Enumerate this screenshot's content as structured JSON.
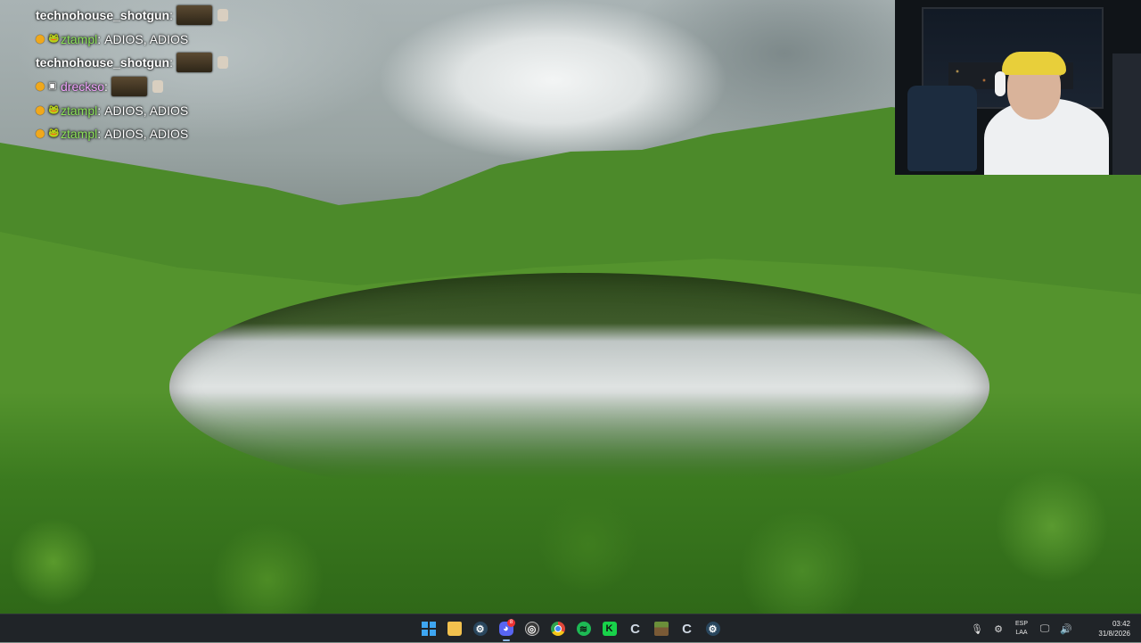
{
  "chat": {
    "messages": [
      {
        "user": "technohouse_shotgun",
        "separator": ":",
        "text": "",
        "has_emote": true
      },
      {
        "user": "ztampl",
        "separator": ":",
        "text": "ADIOS, ADIOS",
        "has_emote": false
      },
      {
        "user": "technohouse_shotgun",
        "separator": ":",
        "text": "",
        "has_emote": true
      },
      {
        "user": "drecksо",
        "separator": ":",
        "text": "",
        "has_emote": true
      },
      {
        "user": "ztampl",
        "separator": ":",
        "text": "ADIOS, ADIOS",
        "has_emote": false
      },
      {
        "user": "ztampl",
        "separator": ":",
        "text": "ADIOS, ADIOS",
        "has_emote": false
      }
    ]
  },
  "taskbar": {
    "apps": [
      {
        "name": "start",
        "icon": "windows-icon",
        "color": "#3ea6f2"
      },
      {
        "name": "file-explorer",
        "icon": "folder-icon",
        "color": "#f2c14e"
      },
      {
        "name": "steam",
        "icon": "steam-icon",
        "color": "#2a475e"
      },
      {
        "name": "discord",
        "icon": "discord-icon",
        "color": "#5865f2",
        "badge": "8"
      },
      {
        "name": "obs",
        "icon": "obs-icon",
        "color": "#3a3a3a"
      },
      {
        "name": "chrome",
        "icon": "chrome-icon",
        "color": "#e0463a"
      },
      {
        "name": "spotify",
        "icon": "spotify-icon",
        "color": "#1db954"
      },
      {
        "name": "kick",
        "icon": "kick-icon",
        "color": "#18d24a"
      },
      {
        "name": "ccleaner",
        "icon": "ccleaner-icon",
        "color": "#4f86c6"
      },
      {
        "name": "minecraft",
        "icon": "minecraft-icon",
        "color": "#6b8f3a"
      },
      {
        "name": "ccleaner-2",
        "icon": "ccleaner-icon",
        "color": "#4f86c6"
      },
      {
        "name": "steam-2",
        "icon": "steam-icon",
        "color": "#2a475e"
      }
    ],
    "tray": {
      "lang_top": "ESP",
      "lang_bottom": "LAA",
      "time": "03:42",
      "date": "31/8/2026"
    }
  }
}
